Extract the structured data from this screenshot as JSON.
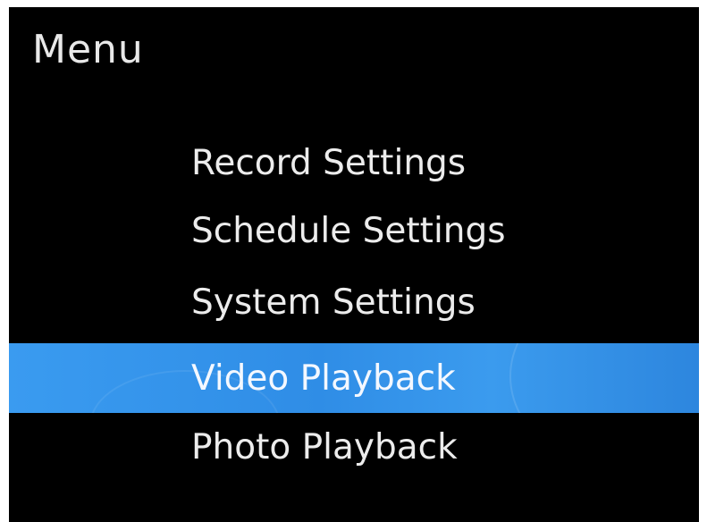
{
  "menu": {
    "title": "Menu",
    "items": [
      {
        "label": "Record Settings",
        "selected": false
      },
      {
        "label": "Schedule Settings",
        "selected": false
      },
      {
        "label": "System Settings",
        "selected": false
      },
      {
        "label": "Video Playback",
        "selected": true
      },
      {
        "label": "Photo Playback",
        "selected": false
      }
    ]
  },
  "colors": {
    "background": "#000000",
    "text": "#ececec",
    "highlight": "#3a9bf0"
  }
}
